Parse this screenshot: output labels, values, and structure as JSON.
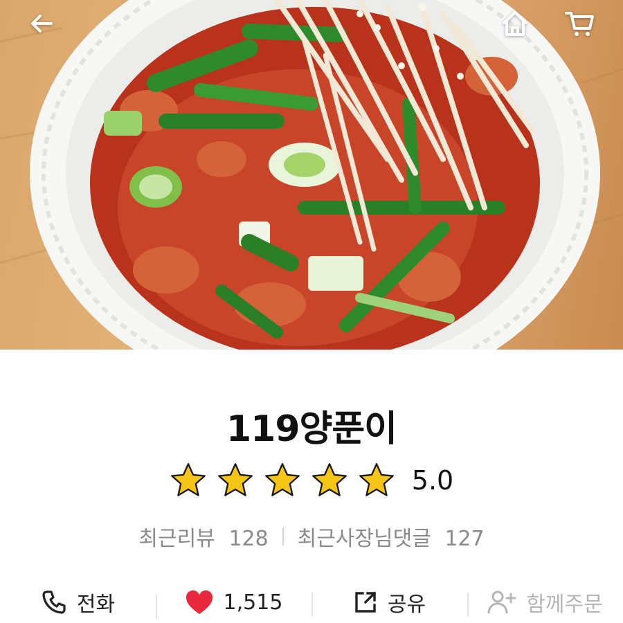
{
  "header": {
    "back_icon": "back-arrow-icon",
    "home_icon": "home-icon",
    "cart_icon": "cart-icon"
  },
  "store": {
    "name": "119양푼이",
    "rating": 5.0,
    "rating_text": "5.0",
    "stars_filled": 5,
    "stars_total": 5,
    "star_color": "#f5c518"
  },
  "stats": {
    "reviews_label": "최근리뷰",
    "reviews_count": "128",
    "owner_replies_label": "최근사장님댓글",
    "owner_replies_count": "127"
  },
  "actions": {
    "call_label": "전화",
    "call_icon": "phone-icon",
    "like_count": "1,515",
    "like_icon": "heart-icon",
    "like_color": "#e8283c",
    "share_label": "공유",
    "share_icon": "share-icon",
    "group_order_label": "함께주문",
    "group_order_icon": "add-person-icon"
  }
}
